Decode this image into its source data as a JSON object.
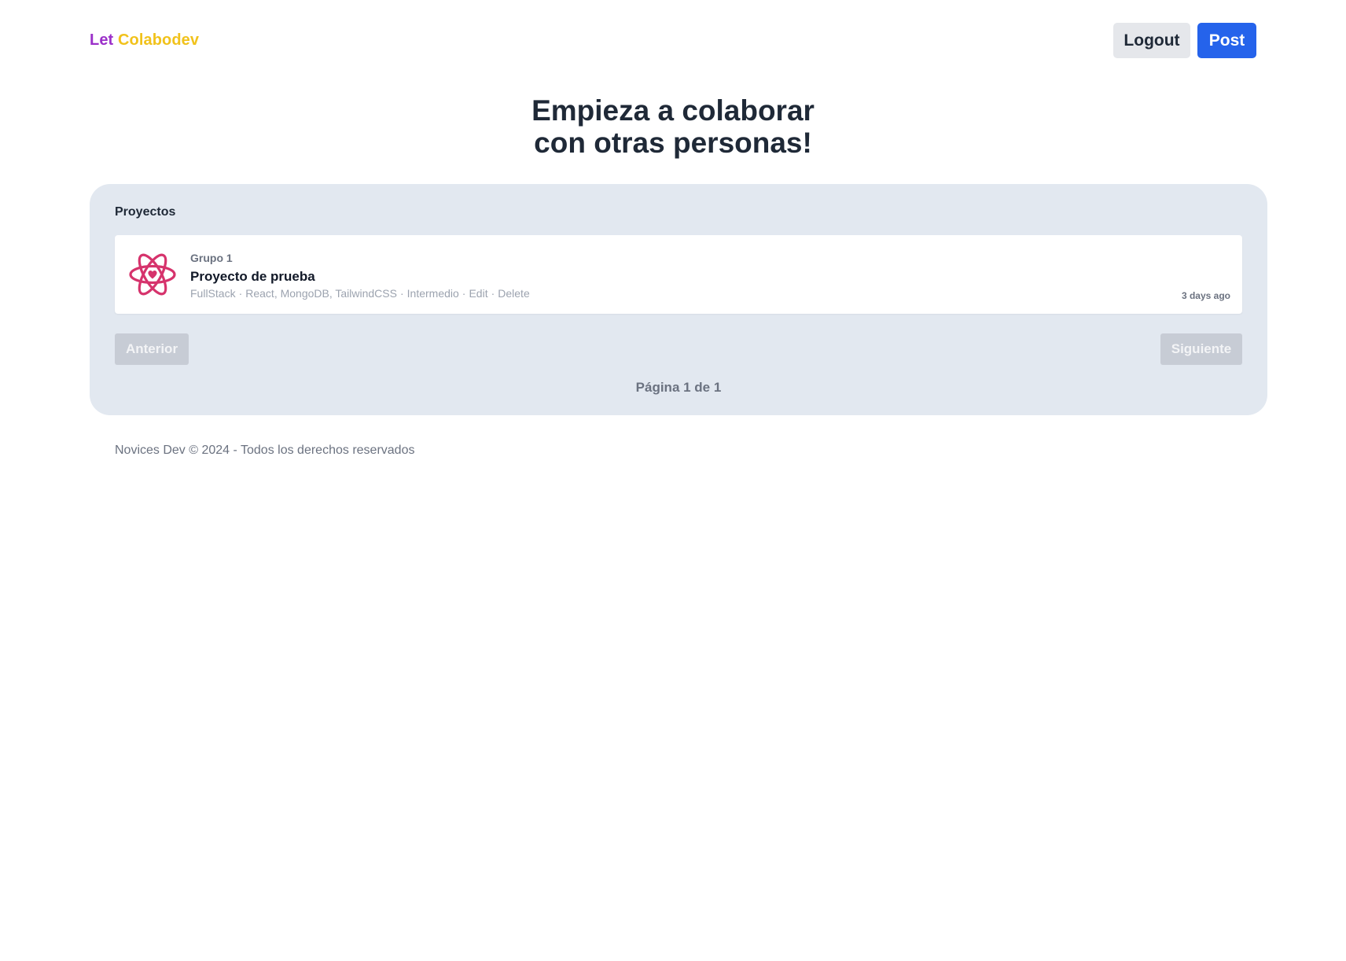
{
  "header": {
    "logo_part1": "Let",
    "logo_part2": "Colabodev",
    "logout_label": "Logout",
    "post_label": "Post"
  },
  "hero": {
    "line1": "Empieza a colaborar",
    "line2": "con otras personas!"
  },
  "projects": {
    "section_title": "Proyectos",
    "items": [
      {
        "icon": "react-atom-heart-icon",
        "group": "Grupo 1",
        "title": "Proyecto de prueba",
        "role": "FullStack",
        "stack": "React, MongoDB, TailwindCSS",
        "level": "Intermedio",
        "edit_label": "Edit",
        "delete_label": "Delete",
        "time_ago": "3 days ago"
      }
    ]
  },
  "pagination": {
    "prev_label": "Anterior",
    "next_label": "Siguiente",
    "indicator": "Página 1 de 1"
  },
  "footer": {
    "text": "Novices Dev © 2024 - Todos los derechos reservados"
  },
  "colors": {
    "logo_let": "#9b30c9",
    "logo_brand": "#f1c21b",
    "post_button": "#2563eb",
    "panel_bg": "#e2e8f0",
    "icon_accent": "#d6336c"
  }
}
